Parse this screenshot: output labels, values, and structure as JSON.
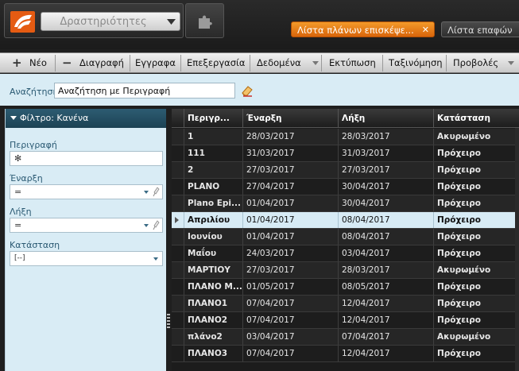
{
  "header": {
    "module_selector": "Δραστηριότητες",
    "tabs": [
      {
        "label": "Λίστα πλάνων επισκέψε...",
        "close": "✕",
        "active": true
      },
      {
        "label": "Λίστα επαφών",
        "active": false
      }
    ]
  },
  "toolbar": {
    "new_icon": "+",
    "new_label": "Νέο",
    "delete_icon": "−",
    "delete_label": "Διαγραφή",
    "documents_label": "Εγγραφα",
    "processing_label": "Επεξεργασία",
    "data_label": "Δεδομένα",
    "print_label": "Εκτύπωση",
    "sort_label": "Ταξινόμηση",
    "views_label": "Προβολές"
  },
  "search": {
    "label": "Αναζήτηση",
    "value": "Αναζήτηση με Περιγραφή"
  },
  "filter": {
    "header": "Φίλτρο: Κανένα",
    "fields": [
      {
        "label": "Περιγραφή",
        "value": "✻"
      },
      {
        "label": "Έναρξη",
        "value": "="
      },
      {
        "label": "Λήξη",
        "value": "="
      },
      {
        "label": "Κατάσταση",
        "value": "[--]"
      }
    ]
  },
  "grid": {
    "columns": [
      "Περιγρ...",
      "Έναρξη",
      "Λήξη",
      "Κατάσταση"
    ],
    "rows": [
      {
        "desc": "1",
        "start": "28/03/2017",
        "end": "28/03/2017",
        "status": "Ακυρωμένο"
      },
      {
        "desc": "111",
        "start": "31/03/2017",
        "end": "31/03/2017",
        "status": "Πρόχειρο"
      },
      {
        "desc": "2",
        "start": "27/03/2017",
        "end": "27/03/2017",
        "status": "Πρόχειρο"
      },
      {
        "desc": "PLANO",
        "start": "27/04/2017",
        "end": "30/04/2017",
        "status": "Πρόχειρο"
      },
      {
        "desc": "Plano Epi...",
        "start": "01/04/2017",
        "end": "30/04/2017",
        "status": "Πρόχειρο"
      },
      {
        "desc": "Απριλίου",
        "start": "01/04/2017",
        "end": "08/04/2017",
        "status": "Πρόχειρο"
      },
      {
        "desc": "Ιουνίου",
        "start": "01/04/2017",
        "end": "08/04/2017",
        "status": "Πρόχειρο"
      },
      {
        "desc": "Μαΐου",
        "start": "24/03/2017",
        "end": "03/04/2017",
        "status": "Πρόχειρο"
      },
      {
        "desc": "ΜΑΡΤΙΟΥ",
        "start": "27/03/2017",
        "end": "28/03/2017",
        "status": "Ακυρωμένο"
      },
      {
        "desc": "ΠΛΑΝΟ Μ...",
        "start": "01/05/2017",
        "end": "08/05/2017",
        "status": "Πρόχειρο"
      },
      {
        "desc": "ΠΛΑΝΟ1",
        "start": "07/04/2017",
        "end": "12/04/2017",
        "status": "Πρόχειρο"
      },
      {
        "desc": "ΠΛΑΝΟ2",
        "start": "07/04/2017",
        "end": "12/04/2017",
        "status": "Πρόχειρο"
      },
      {
        "desc": "πλάνο2",
        "start": "03/04/2017",
        "end": "07/04/2017",
        "status": "Ακυρωμένο"
      },
      {
        "desc": "ΠΛΑΝΟ3",
        "start": "07/04/2017",
        "end": "12/04/2017",
        "status": "Πρόχειρο"
      }
    ]
  }
}
